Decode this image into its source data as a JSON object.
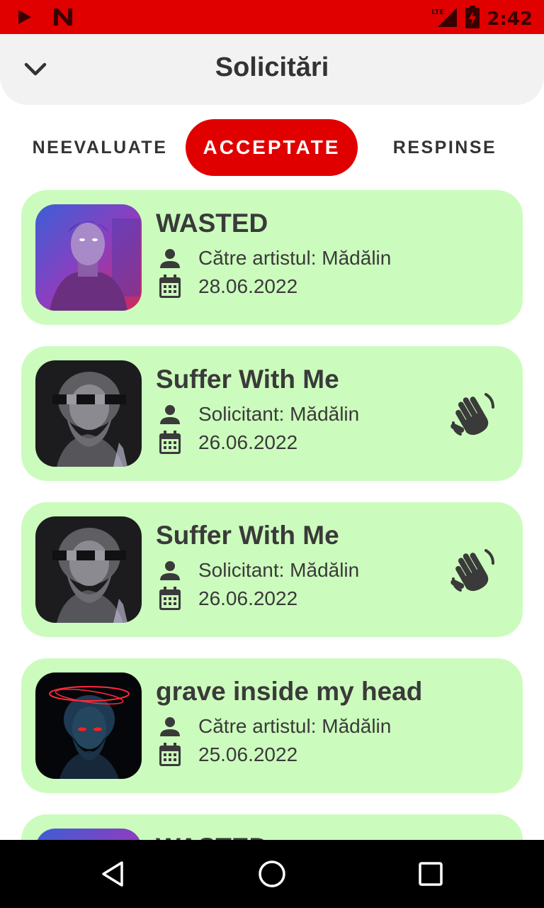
{
  "status_bar": {
    "time": "2:42",
    "network": "LTE"
  },
  "header": {
    "title": "Solicitări"
  },
  "tabs": [
    {
      "label": "NEEVALUATE"
    },
    {
      "label": "ACCEPTATE"
    },
    {
      "label": "RESPINSE"
    }
  ],
  "requests": [
    {
      "title": "WASTED",
      "person": "Către artistul: Mădălin",
      "date": "28.06.2022",
      "cover": "statue-neon-purple",
      "wave_icon": false
    },
    {
      "title": "Suffer With Me",
      "person": "Solicitant: Mădălin",
      "date": "26.06.2022",
      "cover": "bearded-statue-glitch",
      "wave_icon": true
    },
    {
      "title": "Suffer With Me",
      "person": "Solicitant: Mădălin",
      "date": "26.06.2022",
      "cover": "bearded-statue-glitch",
      "wave_icon": true
    },
    {
      "title": "grave inside my head",
      "person": "Către artistul: Mădălin",
      "date": "25.06.2022",
      "cover": "dark-statue-red-halo",
      "wave_icon": false
    },
    {
      "title": "WASTED",
      "cover": "statue-neon-purple"
    }
  ],
  "colors": {
    "accent": "#e10000",
    "card_background": "#ccfcbd",
    "text": "#3a3a3a",
    "header_background": "#f2f2f2"
  }
}
